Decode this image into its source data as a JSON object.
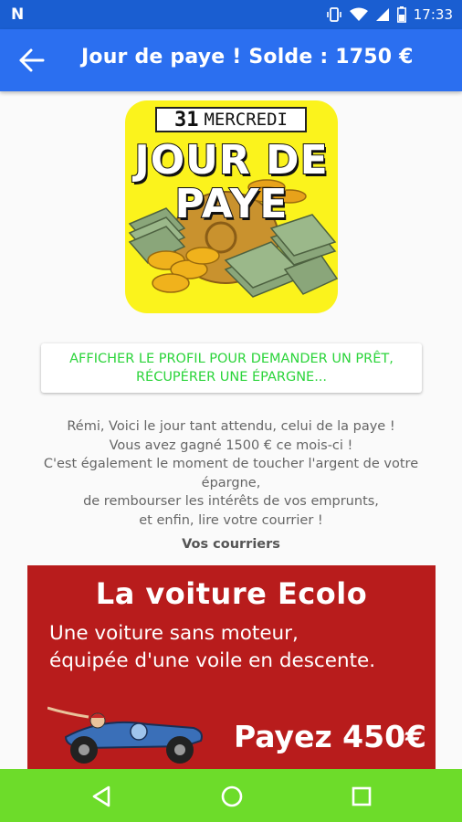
{
  "status_bar": {
    "notification_letter": "N",
    "time": "17:33",
    "icons": [
      "vibrate-icon",
      "wifi-icon",
      "signal-icon",
      "battery-icon"
    ]
  },
  "app_bar": {
    "title": "Jour de paye ! Solde : 1750 €",
    "back_icon": "arrow-left-icon",
    "color": "#2b6ff0"
  },
  "payday_image": {
    "day_number": "31",
    "day_name": "MERCREDI",
    "line1": "JOUR DE",
    "line2": "PAYE",
    "background": "#fbf31c"
  },
  "profile_button": {
    "line1": "AFFICHER LE PROFIL POUR DEMANDER UN PRÊT,",
    "line2": "RÉCUPÉRER UNE ÉPARGNE...",
    "color": "#2bd43a"
  },
  "message": {
    "lines": [
      "Rémi, Voici le jour tant attendu, celui de la paye !",
      "Vous avez gagné 1500 € ce mois-ci !",
      "C'est également le moment de toucher l'argent de votre",
      "épargne,",
      "de rembourser les intérêts de vos emprunts,",
      "et enfin, lire votre courrier !"
    ]
  },
  "mail": {
    "heading": "Vos courriers",
    "card": {
      "title": "La voiture Ecolo",
      "text_line1": "Une voiture sans moteur,",
      "text_line2": "équipée d'une voile en descente.",
      "price": "Payez 450€",
      "background": "#b81c1c"
    }
  },
  "nav_bar": {
    "buttons": [
      "back-triangle-icon",
      "home-circle-icon",
      "recents-square-icon"
    ],
    "color": "#6ddc2a"
  }
}
